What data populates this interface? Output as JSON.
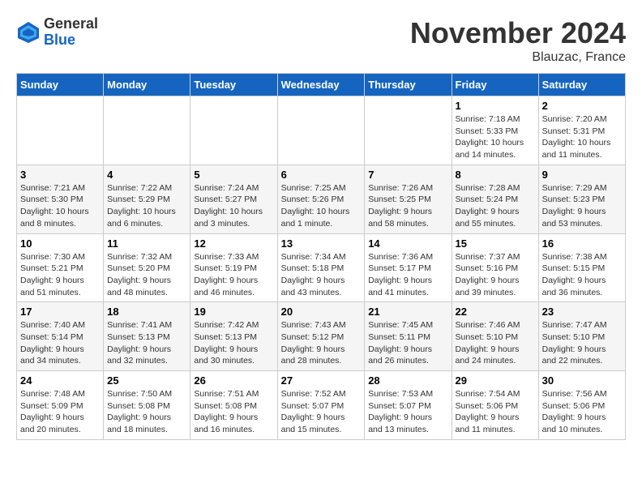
{
  "logo": {
    "general": "General",
    "blue": "Blue"
  },
  "title": "November 2024",
  "location": "Blauzac, France",
  "days_of_week": [
    "Sunday",
    "Monday",
    "Tuesday",
    "Wednesday",
    "Thursday",
    "Friday",
    "Saturday"
  ],
  "weeks": [
    [
      {
        "day": "",
        "info": ""
      },
      {
        "day": "",
        "info": ""
      },
      {
        "day": "",
        "info": ""
      },
      {
        "day": "",
        "info": ""
      },
      {
        "day": "",
        "info": ""
      },
      {
        "day": "1",
        "info": "Sunrise: 7:18 AM\nSunset: 5:33 PM\nDaylight: 10 hours\nand 14 minutes."
      },
      {
        "day": "2",
        "info": "Sunrise: 7:20 AM\nSunset: 5:31 PM\nDaylight: 10 hours\nand 11 minutes."
      }
    ],
    [
      {
        "day": "3",
        "info": "Sunrise: 7:21 AM\nSunset: 5:30 PM\nDaylight: 10 hours\nand 8 minutes."
      },
      {
        "day": "4",
        "info": "Sunrise: 7:22 AM\nSunset: 5:29 PM\nDaylight: 10 hours\nand 6 minutes."
      },
      {
        "day": "5",
        "info": "Sunrise: 7:24 AM\nSunset: 5:27 PM\nDaylight: 10 hours\nand 3 minutes."
      },
      {
        "day": "6",
        "info": "Sunrise: 7:25 AM\nSunset: 5:26 PM\nDaylight: 10 hours\nand 1 minute."
      },
      {
        "day": "7",
        "info": "Sunrise: 7:26 AM\nSunset: 5:25 PM\nDaylight: 9 hours\nand 58 minutes."
      },
      {
        "day": "8",
        "info": "Sunrise: 7:28 AM\nSunset: 5:24 PM\nDaylight: 9 hours\nand 55 minutes."
      },
      {
        "day": "9",
        "info": "Sunrise: 7:29 AM\nSunset: 5:23 PM\nDaylight: 9 hours\nand 53 minutes."
      }
    ],
    [
      {
        "day": "10",
        "info": "Sunrise: 7:30 AM\nSunset: 5:21 PM\nDaylight: 9 hours\nand 51 minutes."
      },
      {
        "day": "11",
        "info": "Sunrise: 7:32 AM\nSunset: 5:20 PM\nDaylight: 9 hours\nand 48 minutes."
      },
      {
        "day": "12",
        "info": "Sunrise: 7:33 AM\nSunset: 5:19 PM\nDaylight: 9 hours\nand 46 minutes."
      },
      {
        "day": "13",
        "info": "Sunrise: 7:34 AM\nSunset: 5:18 PM\nDaylight: 9 hours\nand 43 minutes."
      },
      {
        "day": "14",
        "info": "Sunrise: 7:36 AM\nSunset: 5:17 PM\nDaylight: 9 hours\nand 41 minutes."
      },
      {
        "day": "15",
        "info": "Sunrise: 7:37 AM\nSunset: 5:16 PM\nDaylight: 9 hours\nand 39 minutes."
      },
      {
        "day": "16",
        "info": "Sunrise: 7:38 AM\nSunset: 5:15 PM\nDaylight: 9 hours\nand 36 minutes."
      }
    ],
    [
      {
        "day": "17",
        "info": "Sunrise: 7:40 AM\nSunset: 5:14 PM\nDaylight: 9 hours\nand 34 minutes."
      },
      {
        "day": "18",
        "info": "Sunrise: 7:41 AM\nSunset: 5:13 PM\nDaylight: 9 hours\nand 32 minutes."
      },
      {
        "day": "19",
        "info": "Sunrise: 7:42 AM\nSunset: 5:13 PM\nDaylight: 9 hours\nand 30 minutes."
      },
      {
        "day": "20",
        "info": "Sunrise: 7:43 AM\nSunset: 5:12 PM\nDaylight: 9 hours\nand 28 minutes."
      },
      {
        "day": "21",
        "info": "Sunrise: 7:45 AM\nSunset: 5:11 PM\nDaylight: 9 hours\nand 26 minutes."
      },
      {
        "day": "22",
        "info": "Sunrise: 7:46 AM\nSunset: 5:10 PM\nDaylight: 9 hours\nand 24 minutes."
      },
      {
        "day": "23",
        "info": "Sunrise: 7:47 AM\nSunset: 5:10 PM\nDaylight: 9 hours\nand 22 minutes."
      }
    ],
    [
      {
        "day": "24",
        "info": "Sunrise: 7:48 AM\nSunset: 5:09 PM\nDaylight: 9 hours\nand 20 minutes."
      },
      {
        "day": "25",
        "info": "Sunrise: 7:50 AM\nSunset: 5:08 PM\nDaylight: 9 hours\nand 18 minutes."
      },
      {
        "day": "26",
        "info": "Sunrise: 7:51 AM\nSunset: 5:08 PM\nDaylight: 9 hours\nand 16 minutes."
      },
      {
        "day": "27",
        "info": "Sunrise: 7:52 AM\nSunset: 5:07 PM\nDaylight: 9 hours\nand 15 minutes."
      },
      {
        "day": "28",
        "info": "Sunrise: 7:53 AM\nSunset: 5:07 PM\nDaylight: 9 hours\nand 13 minutes."
      },
      {
        "day": "29",
        "info": "Sunrise: 7:54 AM\nSunset: 5:06 PM\nDaylight: 9 hours\nand 11 minutes."
      },
      {
        "day": "30",
        "info": "Sunrise: 7:56 AM\nSunset: 5:06 PM\nDaylight: 9 hours\nand 10 minutes."
      }
    ]
  ]
}
